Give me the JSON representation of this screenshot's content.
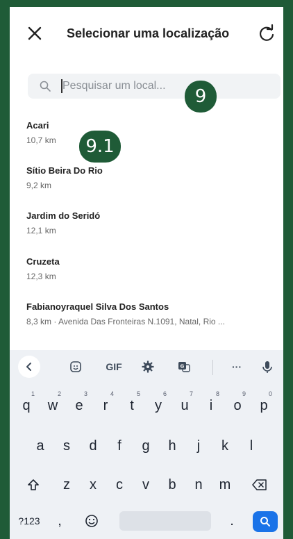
{
  "header": {
    "title": "Selecionar uma localização"
  },
  "search": {
    "placeholder": "Pesquisar um local..."
  },
  "badges": {
    "search_step": "9",
    "list_step": "9.1"
  },
  "locations": [
    {
      "name": "Acari",
      "detail": "10,7 km"
    },
    {
      "name": "Sítio Beira Do Rio",
      "detail": "9,2 km"
    },
    {
      "name": "Jardim do Seridó",
      "detail": "12,1 km"
    },
    {
      "name": "Cruzeta",
      "detail": "12,3 km"
    },
    {
      "name": "Fabianoyraquel Silva Dos Santos",
      "detail": "8,3 km · Avenida Das Fronteiras N.1091, Natal, Rio ..."
    }
  ],
  "keyboard": {
    "toolbar": {
      "gif": "GIF",
      "more": "···"
    },
    "row1": [
      {
        "key": "q",
        "hint": "1"
      },
      {
        "key": "w",
        "hint": "2"
      },
      {
        "key": "e",
        "hint": "3"
      },
      {
        "key": "r",
        "hint": "4"
      },
      {
        "key": "t",
        "hint": "5"
      },
      {
        "key": "y",
        "hint": "6"
      },
      {
        "key": "u",
        "hint": "7"
      },
      {
        "key": "i",
        "hint": "8"
      },
      {
        "key": "o",
        "hint": "9"
      },
      {
        "key": "p",
        "hint": "0"
      }
    ],
    "row2": [
      "a",
      "s",
      "d",
      "f",
      "g",
      "h",
      "j",
      "k",
      "l"
    ],
    "row3": [
      "z",
      "x",
      "c",
      "v",
      "b",
      "n",
      "m"
    ],
    "symbols": "?123",
    "comma": ",",
    "period": "."
  },
  "colors": {
    "frame": "#1f5b37",
    "accent": "#1a73e8"
  }
}
